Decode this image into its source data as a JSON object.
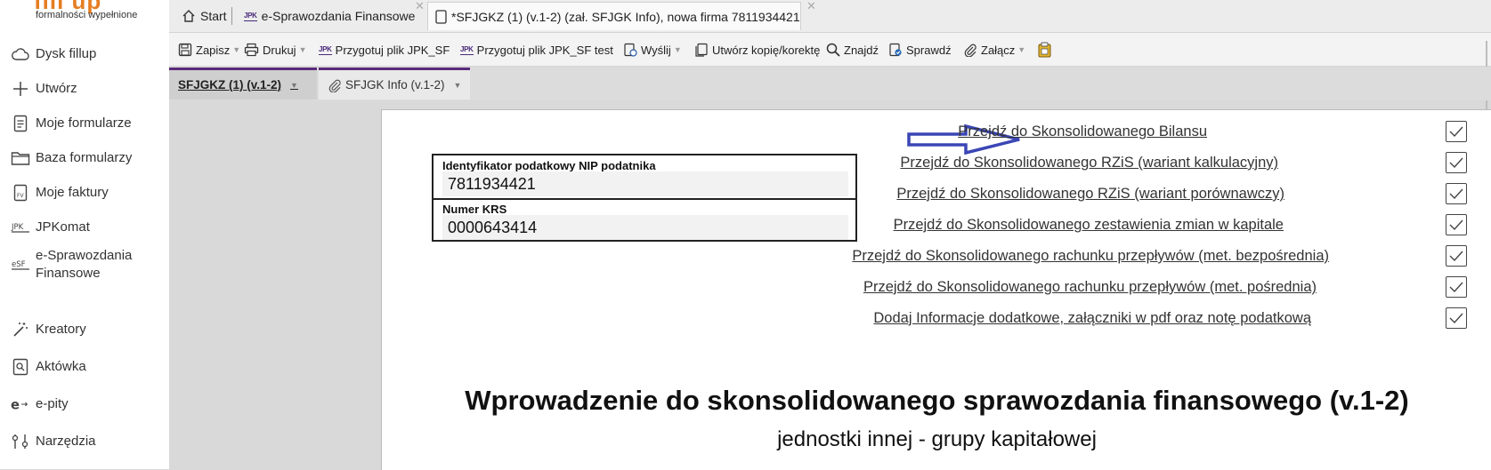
{
  "app": {
    "logo_text": "fill up",
    "logo_tagline": "formalności wypełnione"
  },
  "sidebar": {
    "items": [
      {
        "label": "Dysk fillup",
        "icon": "cloud-icon"
      },
      {
        "label": "Utwórz",
        "icon": "plus-icon"
      },
      {
        "label": "Moje formularze",
        "icon": "document-icon"
      },
      {
        "label": "Baza formularzy",
        "icon": "folder-icon"
      },
      {
        "label": "Moje faktury",
        "icon": "invoice-icon"
      },
      {
        "label": "JPKomat",
        "icon": "jpk-icon"
      },
      {
        "label": "e-Sprawozdania Finansowe",
        "icon": "esf-icon"
      },
      {
        "label": "Kreatory",
        "icon": "magic-wand-icon"
      },
      {
        "label": "Aktówka",
        "icon": "briefcase-icon"
      },
      {
        "label": "e-pity",
        "icon": "epity-icon"
      },
      {
        "label": "Narzędzia",
        "icon": "tools-icon"
      }
    ]
  },
  "tabs": {
    "start": "Start",
    "esf": "e-Sprawozdania Finansowe",
    "doc": "*SFJGKZ (1) (v.1-2) (zał. SFJGK Info), nowa firma 7811934421",
    "jpk_badge": "JPK"
  },
  "toolbar": {
    "save": "Zapisz",
    "print": "Drukuj",
    "prep_jpk": "Przygotuj plik JPK_SF",
    "prep_jpk_test": "Przygotuj plik JPK_SF test",
    "send": "Wyślij",
    "copy": "Utwórz kopię/korektę",
    "find": "Znajdź",
    "check": "Sprawdź",
    "attach": "Załącz",
    "jpk_badge": "JPK"
  },
  "subtabs": {
    "first": "SFJGKZ (1) (v.1-2)",
    "second": "SFJGK Info (v.1-2)"
  },
  "form": {
    "nip_label": "Identyfikator podatkowy NIP podatnika",
    "nip_value": "7811934421",
    "krs_label": "Numer KRS",
    "krs_value": "0000643414",
    "links": [
      "Przejdź do Skonsolidowanego Bilansu",
      "Przejdź do Skonsolidowanego RZiS (wariant kalkulacyjny)",
      "Przejdź do Skonsolidowanego RZiS (wariant porównawczy)",
      "Przejdź do Skonsolidowanego zestawienia zmian w kapitale",
      "Przejdź do Skonsolidowanego rachunku przepływów (met. bezpośrednia)",
      "Przejdź do Skonsolidowanego rachunku przepływów (met. pośrednia)",
      "Dodaj Informacje dodatkowe, załączniki w pdf oraz notę podatkową"
    ],
    "title": "Wprowadzenie do skonsolidowanego sprawozdania finansowego (v.1-2)",
    "subtitle": "jednostki innej - grupy kapitałowej"
  },
  "colors": {
    "accent": "#5a2a7a",
    "arrow": "#3a46b5",
    "logo": "#e67e22"
  }
}
